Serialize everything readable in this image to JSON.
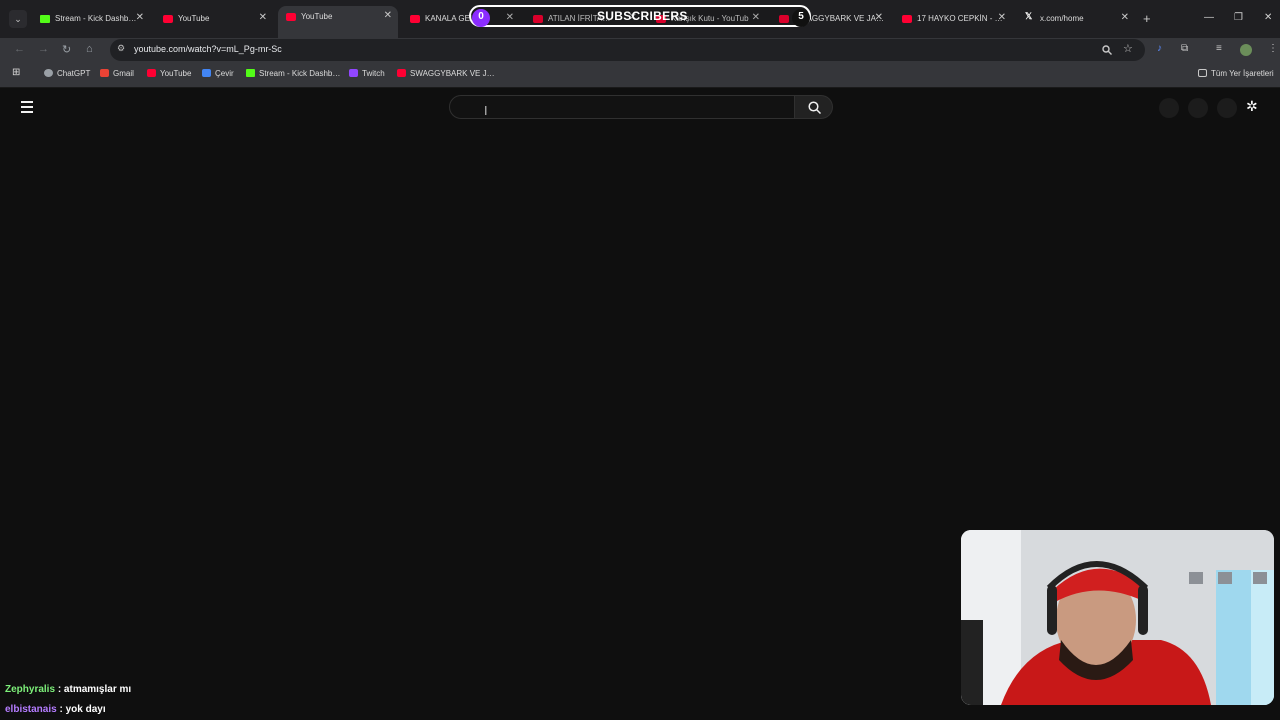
{
  "tabs": [
    {
      "title": "Stream - Kick Dashb…",
      "favicon": "kick-icon",
      "active": false
    },
    {
      "title": "YouTube",
      "favicon": "youtube-icon",
      "active": false
    },
    {
      "title": "YouTube",
      "favicon": "youtube-icon",
      "active": true
    },
    {
      "title": "KANALA GEL…",
      "favicon": "youtube-icon",
      "active": false
    },
    {
      "title": "ATILAN İFRİTA…",
      "favicon": "youtube-icon",
      "active": false
    },
    {
      "title": "Karışık Kutu - YouTub",
      "favicon": "youtube-icon",
      "active": false
    },
    {
      "title": "SWAGGYBARK VE JA…",
      "favicon": "youtube-icon",
      "active": false
    },
    {
      "title": "17 HAYKO CEPKİN - …",
      "favicon": "youtube-icon",
      "active": false
    },
    {
      "title": "x.com/home",
      "favicon": "x-icon",
      "active": false
    }
  ],
  "subscribers_widget": {
    "label": "SUBSCRIBERS",
    "left_count": "0",
    "right_count": "5"
  },
  "address_bar": {
    "url": "youtube.com/watch?v=mL_Pg-mr-Sc"
  },
  "bookmarks": [
    {
      "label": "ChatGPT",
      "icon": "chatgpt-icon"
    },
    {
      "label": "Gmail",
      "icon": "gmail-icon"
    },
    {
      "label": "YouTube",
      "icon": "youtube-icon"
    },
    {
      "label": "Çevir",
      "icon": "translate-icon"
    },
    {
      "label": "Stream - Kick Dashb…",
      "icon": "kick-icon"
    },
    {
      "label": "Twitch",
      "icon": "twitch-icon"
    },
    {
      "label": "SWAGGYBARK VE J…",
      "icon": "youtube-icon"
    }
  ],
  "all_bookmarks_label": "Tüm Yer İşaretleri",
  "youtube": {
    "search_value": ""
  },
  "chat": [
    {
      "user": "Zephyralis",
      "message": ": atmamışlar mı"
    },
    {
      "user": "elbistanais",
      "message": ": yok dayı"
    }
  ],
  "colors": {
    "page_bg": "#0f0f0f",
    "tabbar_bg": "#1f1f22",
    "toolbar_bg": "#35363a",
    "youtube_red": "#ff0033",
    "kick_green": "#53fc18",
    "subscriber_purple": "#8b2cff",
    "chat_user_green": "#7df07a",
    "chat_user_purple": "#b47cff"
  }
}
